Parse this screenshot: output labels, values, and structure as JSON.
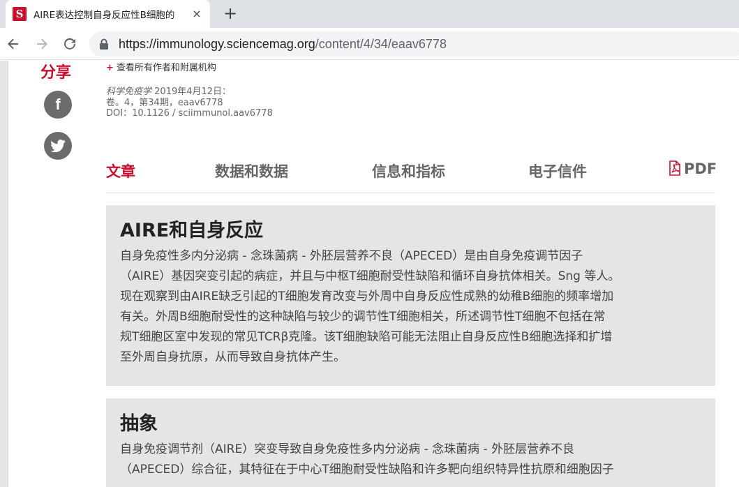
{
  "browser": {
    "tab_title": "AIRE表达控制自身反应性B细胞的",
    "favicon_letter": "S",
    "tab_close": "×",
    "new_tab": "+",
    "url_host": "https://immunology.sciencemag.org",
    "url_path": "/content/4/34/eaav6778"
  },
  "sidebar": {
    "share_label": "分享",
    "social": [
      {
        "icon": "facebook-icon",
        "glyph": "f"
      },
      {
        "icon": "twitter-icon"
      }
    ]
  },
  "article": {
    "authors_link": "查看所有作者和附属机构",
    "authors_prefix": "+",
    "journal": "科学免疫学",
    "date": "2019年4月12日：",
    "volume": "卷。4，第34期，eaav6778",
    "doi": "DOI：10.1126 / sciimmunol.aav6778",
    "tabs": [
      {
        "label": "文章",
        "active": true
      },
      {
        "label": "数据和数据",
        "active": false
      },
      {
        "label": "信息和指标",
        "active": false
      },
      {
        "label": "电子信件",
        "active": false
      },
      {
        "label": "PDF",
        "active": false
      }
    ],
    "sections": [
      {
        "heading": "AIRE和自身反应",
        "lines": [
          "自身免疫性多内分泌病 - 念珠菌病 - 外胚层营养不良（APECED）是由自身免疫调节因子",
          "（AIRE）基因突变引起的病症，并且与中枢T细胞耐受性缺陷和循环自身抗体相关。Sng 等人。",
          "现在观察到由AIRE缺乏引起的T细胞发育改变与外周中自身反应性成熟的幼稚B细胞的频率增加",
          "有关。外周B细胞耐受性的这种缺陷与较少的调节性T细胞相关，所述调节性T细胞不包括在常",
          "规T细胞区室中发现的常见TCRβ克隆。该T细胞缺陷可能无法阻止自身反应性B细胞选择和扩增",
          "至外周自身抗原，从而导致自身抗体产生。"
        ]
      },
      {
        "heading": "抽象",
        "lines": [
          "自身免疫调节剂（AIRE）突变导致自身免疫性多内分泌病 - 念珠菌病 - 外胚层营养不良",
          "（APECED）综合征，其特征在于中心T细胞耐受性缺陷和许多靶向组织特异性抗原和细胞因子"
        ]
      }
    ]
  },
  "colors": {
    "brand_red": "#c8102e",
    "box_bg": "#e5e5e5"
  }
}
